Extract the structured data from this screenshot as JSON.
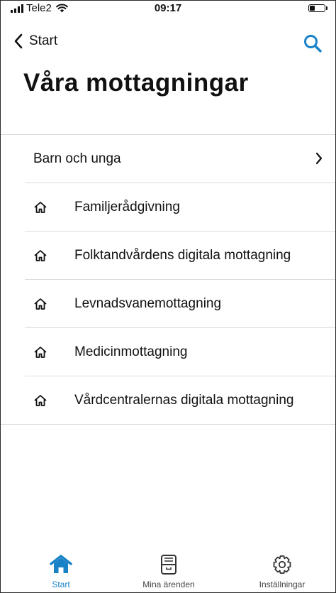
{
  "status_bar": {
    "carrier": "Tele2",
    "time": "09:17",
    "battery_level": 0.35
  },
  "nav": {
    "back_label": "Start"
  },
  "page_title": "Våra mottagningar",
  "list": {
    "category": {
      "label": "Barn och unga"
    },
    "items": [
      {
        "label": "Familjerådgivning"
      },
      {
        "label": "Folktandvårdens digitala mottagning"
      },
      {
        "label": "Levnadsvanemottagning"
      },
      {
        "label": "Medicinmottagning"
      },
      {
        "label": "Vårdcentralernas digitala mottagning"
      }
    ]
  },
  "tab_bar": {
    "tabs": [
      {
        "label": "Start",
        "icon": "home-icon",
        "active": true
      },
      {
        "label": "Mina ärenden",
        "icon": "inbox-tray-icon",
        "active": false
      },
      {
        "label": "Inställningar",
        "icon": "gear-icon",
        "active": false
      }
    ]
  },
  "colors": {
    "accent": "#1a82c6",
    "text": "#111111",
    "divider": "#dcdcdc"
  }
}
